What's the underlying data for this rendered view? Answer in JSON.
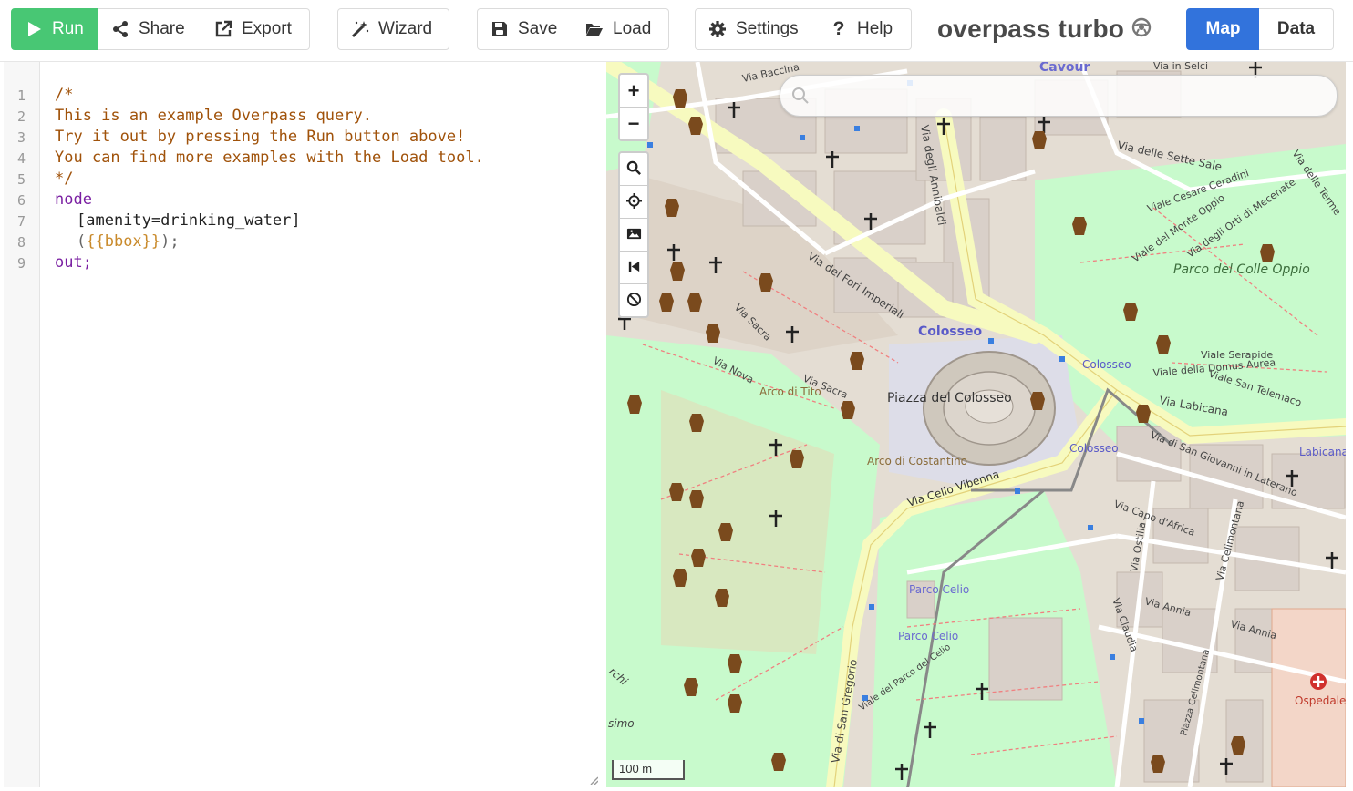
{
  "toolbar": {
    "run": "Run",
    "share": "Share",
    "export": "Export",
    "wizard": "Wizard",
    "save": "Save",
    "load": "Load",
    "settings": "Settings",
    "help": "Help",
    "title": "overpass turbo",
    "map_tab": "Map",
    "data_tab": "Data"
  },
  "editor": {
    "line_numbers": [
      "1",
      "2",
      "3",
      "4",
      "5",
      "6",
      "7",
      "8",
      "9"
    ],
    "lines": [
      "/*",
      "This is an example Overpass query.",
      "Try it out by pressing the Run button above!",
      "You can find more examples with the Load tool.",
      "*/",
      "node",
      "[amenity=drinking_water]",
      "{{bbox}}",
      "out;"
    ]
  },
  "map": {
    "search_placeholder": "",
    "zoom_in": "+",
    "zoom_out": "−",
    "scale": "100 m",
    "labels": {
      "cavour": "Cavour",
      "via_baccina": "Via Baccina",
      "via_in_selci": "Via in Selci",
      "via_annibaldi": "Via degli Annibaldi",
      "sette_sale": "Via delle Sette Sale",
      "viale_ceradini": "Viale Cesare Ceradini",
      "monte_oppio": "Viale del Monte Oppio",
      "orti_mecenate": "Via degli Orti di Mecenate",
      "via_terme": "Via delle Terme",
      "parco_colle_oppio": "Parco del Colle Oppio",
      "fori_imperiali": "Via dei Fori Imperiali",
      "colosseo_station": "Colosseo",
      "colosseo_stop": "Colosseo",
      "colosseo_stop2": "Colosseo",
      "viale_serapide": "Viale Serapide",
      "domus_aurea": "Viale della Domus Aurea",
      "san_telemaco": "Viale San Telemaco",
      "via_labicana": "Via Labicana",
      "labicana": "Labicana",
      "via_sacra": "Via Sacra",
      "via_sacra2": "Via Sacra",
      "via_nova": "Via Nova",
      "arco_tito": "Arco di Tito",
      "piazza_colosseo": "Piazza del Colosseo",
      "arco_costantino": "Arco di Costantino",
      "celio_vibenna": "Via Celio Vibenna",
      "san_giovanni_laterano": "Via di San Giovanni in Laterano",
      "capo_africa": "Via Capo d'Africa",
      "via_ostilia": "Via Ostilia",
      "celimontana": "Via Celimontana",
      "via_annia": "Via Annia",
      "via_annia2": "Via Annia",
      "parco_celio": "Parco Celio",
      "parco_celio2": "Parco Celio",
      "via_claudia": "Via Claudia",
      "san_gregorio": "Via di San Gregorio",
      "viale_parco_celio": "Viale del Parco del Celio",
      "piazza_celimontana": "Piazza Celimontana",
      "ospedale": "Ospedale Militare Celio",
      "simo": "simo",
      "archi": "rchi"
    }
  },
  "colors": {
    "run_green": "#48c774",
    "map_blue": "#3273dc",
    "comment": "#a0520a",
    "keyword": "#7a1fa2",
    "park_green": "#c8facc",
    "road_yellow": "#f7fabf",
    "building": "#d9d0c9"
  }
}
